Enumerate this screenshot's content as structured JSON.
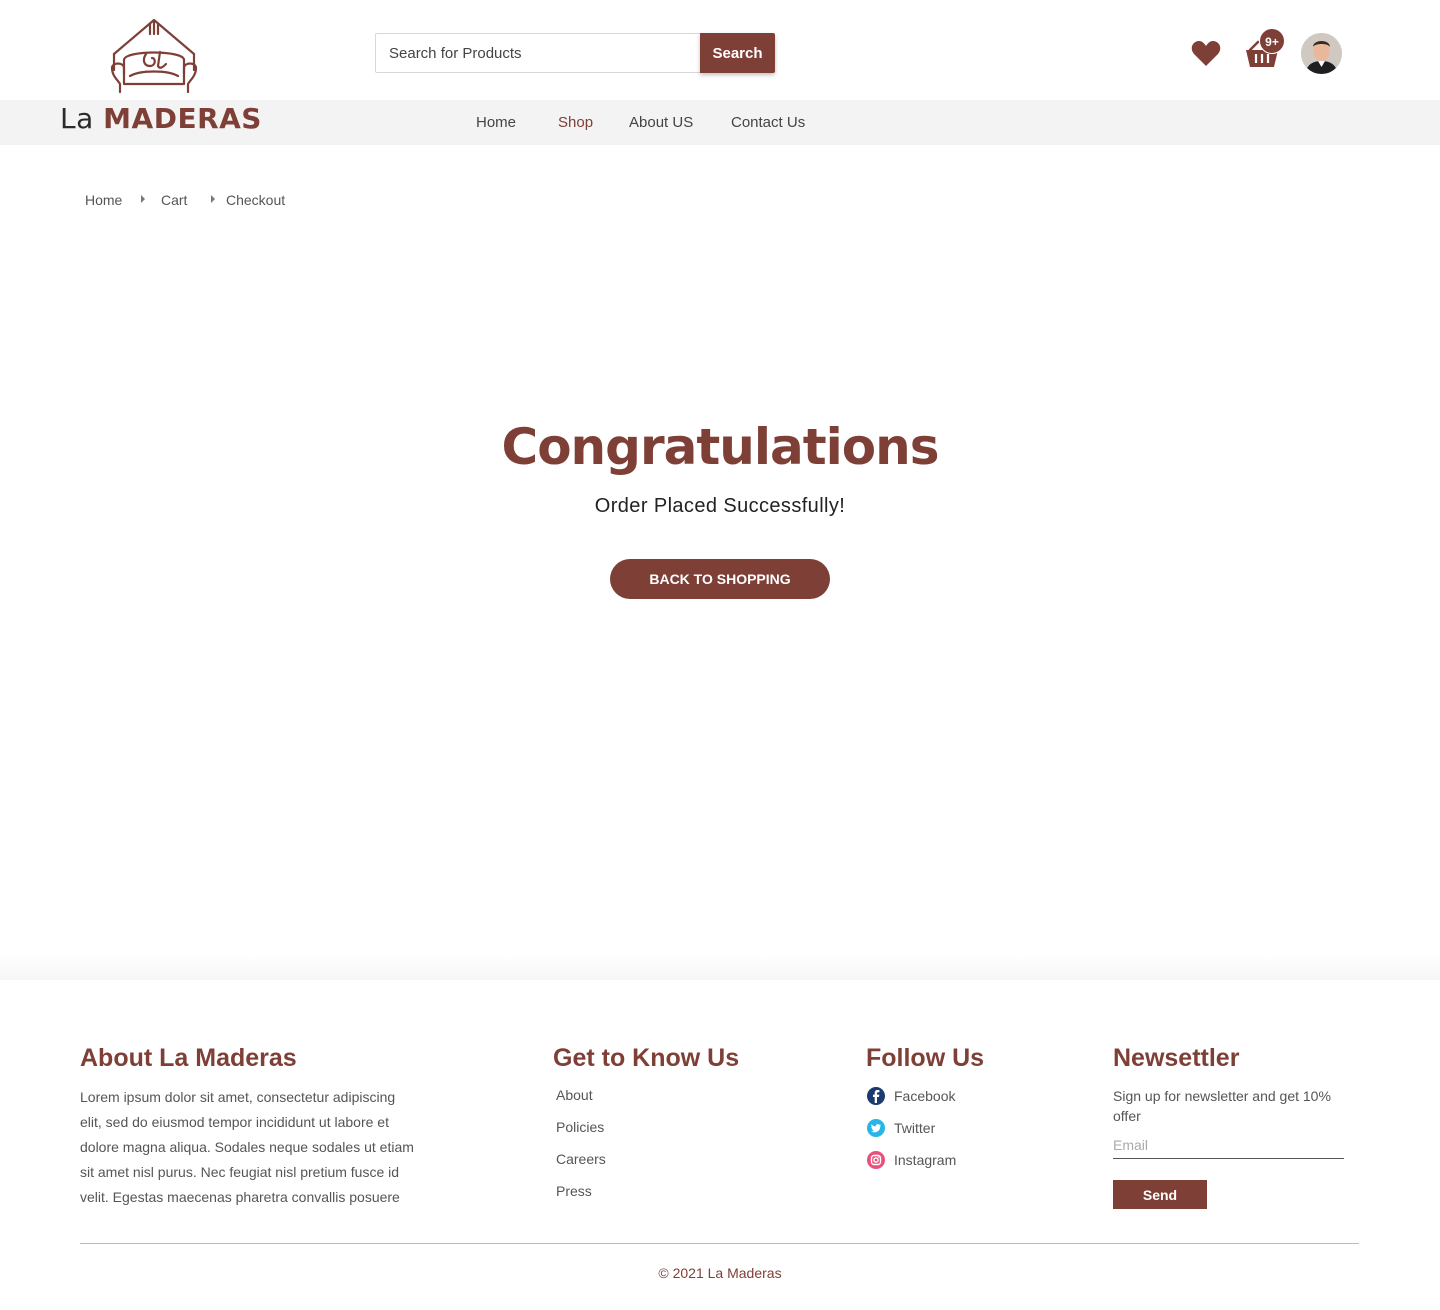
{
  "brand": {
    "logo_mark_text": "la",
    "name_prefix": "La",
    "name_main": "MADERAS",
    "color": "#7e3f37"
  },
  "header": {
    "search_placeholder": "Search for Products",
    "search_button": "Search",
    "cart_badge": "9+",
    "icons": [
      "heart-icon",
      "basket-icon",
      "avatar"
    ]
  },
  "nav": {
    "items": [
      {
        "label": "Home",
        "active": false
      },
      {
        "label": "Shop",
        "active": true
      },
      {
        "label": "About US",
        "active": false
      },
      {
        "label": "Contact Us",
        "active": false
      }
    ]
  },
  "breadcrumb": [
    "Home",
    "Cart",
    "Checkout"
  ],
  "main": {
    "title": "Congratulations",
    "subtitle": "Order Placed Successfully!",
    "button": "BACK TO SHOPPING"
  },
  "footer": {
    "about": {
      "heading": "About La Maderas",
      "text": "Lorem ipsum dolor sit amet, consectetur adipiscing elit, sed do eiusmod tempor incididunt ut labore et dolore magna aliqua. Sodales neque sodales ut etiam sit amet nisl purus. Nec feugiat nisl pretium fusce id velit. Egestas maecenas pharetra convallis posuere"
    },
    "know": {
      "heading": "Get to Know Us",
      "links": [
        "About",
        "Policies",
        "Careers",
        "Press"
      ]
    },
    "follow": {
      "heading": "Follow Us",
      "links": [
        {
          "label": "Facebook",
          "icon": "facebook-icon",
          "color": "#1b3a70"
        },
        {
          "label": "Twitter",
          "icon": "twitter-icon",
          "color": "#1da1f2"
        },
        {
          "label": "Instagram",
          "icon": "instagram-icon",
          "color": "#e1306c"
        }
      ]
    },
    "newsletter": {
      "heading": "Newsettler",
      "text": "Sign up for newsletter and get 10% offer",
      "email_placeholder": "Email",
      "send_button": "Send"
    },
    "copyright": "© 2021 La Maderas"
  }
}
